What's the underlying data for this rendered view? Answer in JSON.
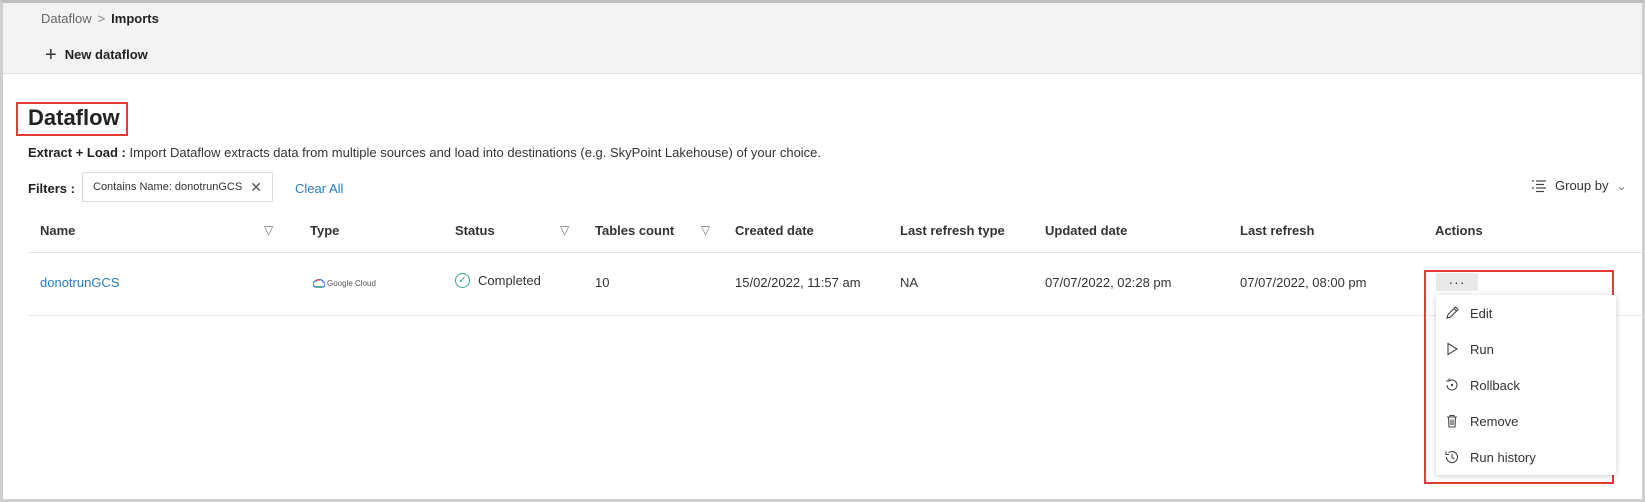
{
  "breadcrumb": {
    "parent": "Dataflow",
    "separator": ">",
    "current": "Imports"
  },
  "toolbar": {
    "new_label": "New dataflow"
  },
  "page": {
    "title": "Dataflow",
    "desc_bold": "Extract + Load :",
    "desc_text": " Import Dataflow extracts data from multiple sources and load into destinations (e.g. SkyPoint Lakehouse) of your choice."
  },
  "filters": {
    "label": "Filters :",
    "chip": "Contains Name: donotrunGCS",
    "clear_all": "Clear All",
    "group_by": "Group by"
  },
  "table": {
    "headers": {
      "name": "Name",
      "type": "Type",
      "status": "Status",
      "tables_count": "Tables count",
      "created": "Created date",
      "last_refresh_type": "Last refresh type",
      "updated": "Updated date",
      "last_refresh": "Last refresh",
      "actions": "Actions"
    },
    "row": {
      "name": "donotrunGCS",
      "type_label": "Google Cloud",
      "status": "Completed",
      "tables_count": "10",
      "created": "15/02/2022, 11:57 am",
      "last_refresh_type": "NA",
      "updated": "07/07/2022, 02:28 pm",
      "last_refresh": "07/07/2022, 08:00 pm"
    }
  },
  "actions_menu": {
    "more": "···",
    "items": [
      "Edit",
      "Run",
      "Rollback",
      "Remove",
      "Run history"
    ]
  },
  "colors": {
    "link": "#2b7bc3",
    "highlight": "#e53935",
    "success": "#3ea37a"
  }
}
